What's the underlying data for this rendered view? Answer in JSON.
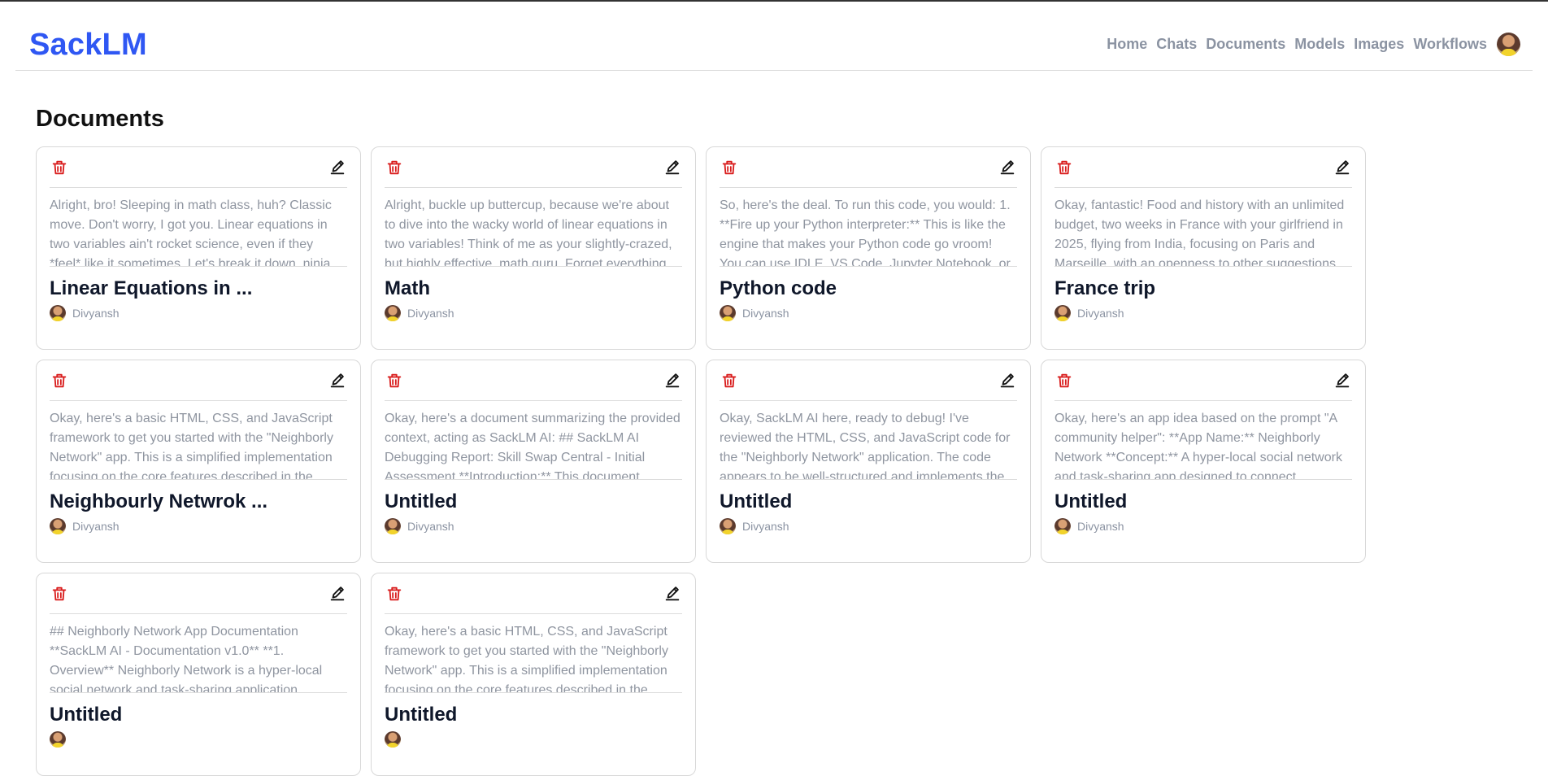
{
  "brand": "SackLM",
  "nav": [
    "Home",
    "Chats",
    "Documents",
    "Models",
    "Images",
    "Workflows"
  ],
  "page_title": "Documents",
  "colors": {
    "brand": "#2f57f3",
    "delete": "#d91d1d",
    "nav": "#8b93a2",
    "preview": "#8f95a0"
  },
  "icons": {
    "delete": "trash-icon",
    "edit": "pencil-icon",
    "user": "avatar"
  },
  "documents": [
    {
      "preview": "Alright, bro! Sleeping in math class, huh? Classic move. Don't worry, I got you. Linear equations in two variables ain't rocket science, even if they *feel* like it sometimes. Let's break it down, ninja-style.",
      "title": "Linear Equations in ...",
      "author": "Divyansh"
    },
    {
      "preview": "Alright, buckle up buttercup, because we're about to dive into the wacky world of linear equations in two variables! Think of me as your slightly-crazed, but highly effective, math guru. Forget everything",
      "title": "Math",
      "author": "Divyansh"
    },
    {
      "preview": "So, here's the deal. To run this code, you would: 1. **Fire up your Python interpreter:** This is like the engine that makes your Python code go vroom! You can use IDLE, VS Code, Jupyter Notebook, or",
      "title": "Python code",
      "author": "Divyansh"
    },
    {
      "preview": "Okay, fantastic! Food and history with an unlimited budget, two weeks in France with your girlfriend in 2025, flying from India, focusing on Paris and Marseille, with an openness to other suggestions...",
      "title": "France trip",
      "author": "Divyansh"
    },
    {
      "preview": "Okay, here's a basic HTML, CSS, and JavaScript framework to get you started with the \"Neighborly Network\" app. This is a simplified implementation focusing on the core features described in the",
      "title": "Neighbourly Netwrok ...",
      "author": "Divyansh"
    },
    {
      "preview": "Okay, here's a document summarizing the provided context, acting as SackLM AI: ## SackLM AI Debugging Report: Skill Swap Central - Initial Assessment **Introduction:** This document",
      "title": "Untitled",
      "author": "Divyansh"
    },
    {
      "preview": "Okay, SackLM AI here, ready to debug! I've reviewed the HTML, CSS, and JavaScript code for the \"Neighborly Network\" application. The code appears to be well-structured and implements the",
      "title": "Untitled",
      "author": "Divyansh"
    },
    {
      "preview": "Okay, here's an app idea based on the prompt \"A community helper\": **App Name:** Neighborly Network **Concept:** A hyper-local social network and task-sharing app designed to connect",
      "title": "Untitled",
      "author": "Divyansh"
    },
    {
      "preview": "## Neighborly Network App Documentation **SackLM AI - Documentation v1.0** **1. Overview** Neighborly Network is a hyper-local social network and task-sharing application",
      "title": "Untitled",
      "author": ""
    },
    {
      "preview": "Okay, here's a basic HTML, CSS, and JavaScript framework to get you started with the \"Neighborly Network\" app. This is a simplified implementation focusing on the core features described in the",
      "title": "Untitled",
      "author": ""
    }
  ]
}
